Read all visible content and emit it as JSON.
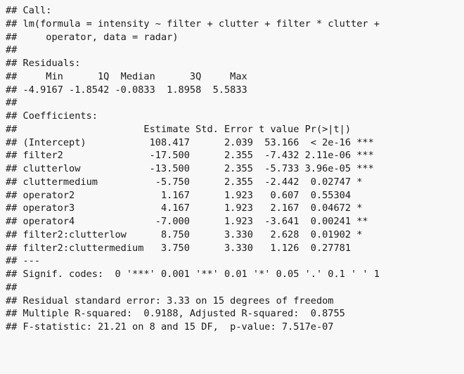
{
  "output": {
    "lines": [
      "## Call:",
      "## lm(formula = intensity ~ filter + clutter + filter * clutter +",
      "##     operator, data = radar)",
      "##",
      "## Residuals:",
      "##     Min      1Q  Median      3Q     Max",
      "## -4.9167 -1.8542 -0.0833  1.8958  5.5833",
      "##",
      "## Coefficients:",
      "##                      Estimate Std. Error t value Pr(>|t|)",
      "## (Intercept)           108.417      2.039  53.166  < 2e-16 ***",
      "## filter2               -17.500      2.355  -7.432 2.11e-06 ***",
      "## clutterlow            -13.500      2.355  -5.733 3.96e-05 ***",
      "## cluttermedium          -5.750      2.355  -2.442  0.02747 *",
      "## operator2               1.167      1.923   0.607  0.55304",
      "## operator3               4.167      1.923   2.167  0.04672 *",
      "## operator4              -7.000      1.923  -3.641  0.00241 **",
      "## filter2:clutterlow      8.750      3.330   2.628  0.01902 *",
      "## filter2:cluttermedium   3.750      3.330   1.126  0.27781",
      "## ---",
      "## Signif. codes:  0 '***' 0.001 '**' 0.01 '*' 0.05 '.' 0.1 ' ' 1",
      "##",
      "## Residual standard error: 3.33 on 15 degrees of freedom",
      "## Multiple R-squared:  0.9188, Adjusted R-squared:  0.8755",
      "## F-statistic: 21.21 on 8 and 15 DF,  p-value: 7.517e-07"
    ]
  }
}
